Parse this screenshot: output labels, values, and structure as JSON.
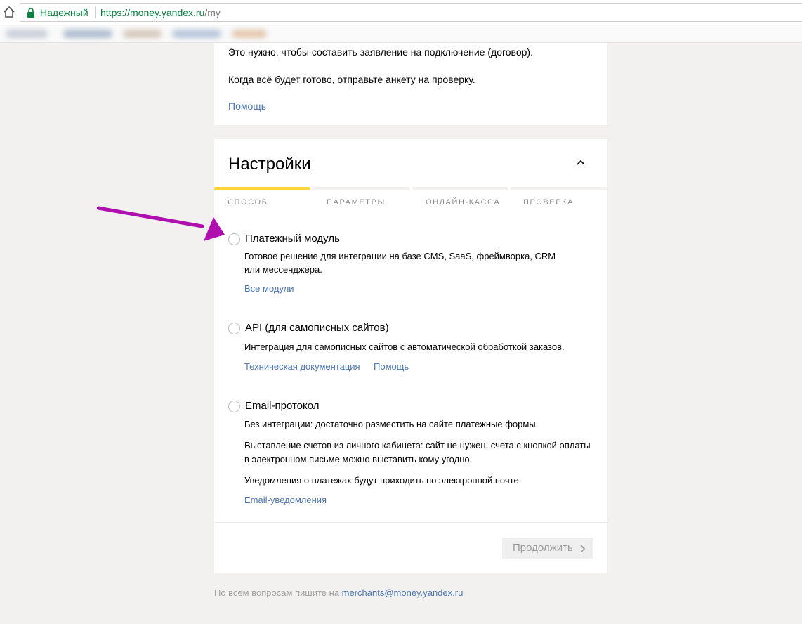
{
  "browser": {
    "secure_label": "Надежный",
    "url_host": "https://money.yandex.ru",
    "url_path": "/my"
  },
  "intro": {
    "line1": "Это нужно, чтобы составить заявление на подключение (договор).",
    "line2": "Когда всё будет готово, отправьте анкету на проверку.",
    "help_link": "Помощь"
  },
  "settings": {
    "title": "Настройки",
    "steps": [
      {
        "label": "СПОСОБ",
        "active": true
      },
      {
        "label": "ПАРАМЕТРЫ",
        "active": false
      },
      {
        "label": "ОНЛАЙН-КАССА",
        "active": false
      },
      {
        "label": "ПРОВЕРКА",
        "active": false
      }
    ],
    "options": [
      {
        "title": "Платежный модуль",
        "desc": [
          "Готовое решение для интеграции на базе CMS, SaaS, фреймворка, CRM",
          "или мессенджера."
        ],
        "links": [
          "Все модули"
        ]
      },
      {
        "title": "API (для самописных сайтов)",
        "desc": [
          "Интеграция для самописных сайтов с автоматической обработкой заказов."
        ],
        "links": [
          "Техническая документация",
          "Помощь"
        ]
      },
      {
        "title": "Email-протокол",
        "desc": [
          "Без интеграции: достаточно разместить на сайте платежные формы.",
          "Выставление счетов из личного кабинета: сайт не нужен, счета с кнопкой оплаты",
          "в электронном письме можно выставить кому угодно.",
          "Уведомления о платежах будут приходить по электронной почте."
        ],
        "links": [
          "Email-уведомления"
        ]
      }
    ],
    "continue_label": "Продолжить"
  },
  "footer": {
    "text": "По всем вопросам пишите на ",
    "email": "merchants@money.yandex.ru"
  },
  "colors": {
    "accent_yellow": "#ffd33c",
    "link_blue": "#4b76b0",
    "annotation_arrow": "#b00fb0"
  }
}
